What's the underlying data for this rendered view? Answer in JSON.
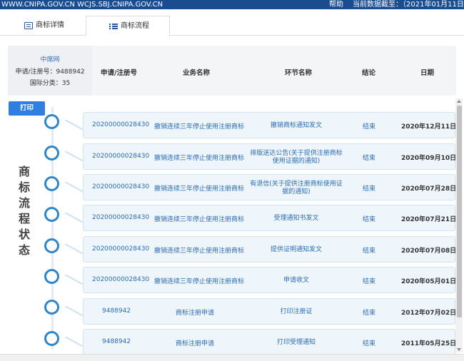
{
  "topbar": {
    "site": "WWW.CNIPA.GOV.CN WCJS.SBJ.CNIPA.GOV.CN",
    "help": "帮助",
    "data_date": "当前数据截至：（2021年01月11日）"
  },
  "tabs": [
    {
      "label": "商标详情",
      "icon": "document-icon"
    },
    {
      "label": "商标流程",
      "icon": "list-icon"
    }
  ],
  "info": {
    "source": "中席网",
    "reg_no": "申请/注册号：9488942",
    "class": "国际分类：35"
  },
  "table": {
    "headers": [
      "申请/注册号",
      "业务名称",
      "环节名称",
      "结论",
      "日期"
    ],
    "rows": [
      {
        "no": "20200000028430",
        "service": "撤销连续三年停止使用注册商标",
        "step": "撤销商标通知发文",
        "result": "结束",
        "date": "2020年12月11日"
      },
      {
        "no": "20200000028430",
        "service": "撤销连续三年停止使用注册商标",
        "step": "排版送达公告(关于提供注册商标使用证据的通知)",
        "result": "结束",
        "date": "2020年09月10日"
      },
      {
        "no": "20200000028430",
        "service": "撤销连续三年停止使用注册商标",
        "step": "有退信(关于提供注册商标使用证据的通知)",
        "result": "结束",
        "date": "2020年07月28日"
      },
      {
        "no": "20200000028430",
        "service": "撤销连续三年停止使用注册商标",
        "step": "受理通知书发文",
        "result": "结束",
        "date": "2020年07月21日"
      },
      {
        "no": "20200000028430",
        "service": "撤销连续三年停止使用注册商标",
        "step": "提供证明通知发文",
        "result": "结束",
        "date": "2020年07月08日"
      },
      {
        "no": "20200000028430",
        "service": "撤销连续三年停止使用注册商标",
        "step": "申请收文",
        "result": "结束",
        "date": "2020年05月01日"
      },
      {
        "no": "9488942",
        "service": "商标注册申请",
        "step": "打印注册证",
        "result": "结束",
        "date": "2012年07月02日"
      },
      {
        "no": "9488942",
        "service": "商标注册申请",
        "step": "打印受理通知",
        "result": "结束",
        "date": "2011年05月25日"
      }
    ]
  },
  "print_label": "打印",
  "side_label": [
    "商",
    "标",
    "流",
    "程",
    "状",
    "态"
  ]
}
